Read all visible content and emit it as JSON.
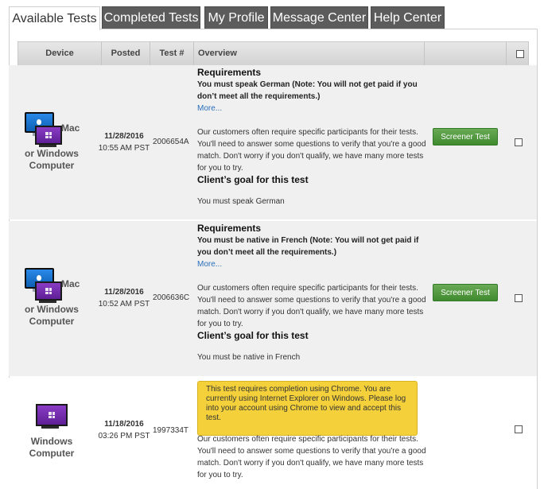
{
  "tabs": [
    {
      "label": "Available Tests",
      "active": true
    },
    {
      "label": "Completed Tests",
      "active": false
    },
    {
      "label": "My Profile",
      "active": false
    },
    {
      "label": "Message Center",
      "active": false
    },
    {
      "label": "Help Center",
      "active": false
    }
  ],
  "table": {
    "headers": {
      "device": "Device",
      "posted": "Posted",
      "test_number": "Test #",
      "overview": "Overview"
    }
  },
  "rows": [
    {
      "device": {
        "line1": "Mac",
        "line2": "or Windows",
        "line3": "Computer"
      },
      "posted_date": "11/28/2016",
      "posted_time": "10:55 AM PST",
      "test_number": "2006654A",
      "requirements_heading": "Requirements",
      "requirement_text": "You must speak German (Note: You will not get paid if you don’t meet all the requirements.)",
      "more_link": "More...",
      "description": "Our customers often require specific participants for their tests. You'll need to answer some questions to verify that you're a good match. Don't worry if you don't qualify, we have many more tests for you to try.",
      "goal_heading": "Client’s goal for this test",
      "goal_text": "You must speak German",
      "button_label": "Screener Test"
    },
    {
      "device": {
        "line1": "Mac",
        "line2": "or Windows",
        "line3": "Computer"
      },
      "posted_date": "11/28/2016",
      "posted_time": "10:52 AM PST",
      "test_number": "2006636C",
      "requirements_heading": "Requirements",
      "requirement_text": "You must be native in French (Note: You will not get paid if you don’t meet all the requirements.)",
      "more_link": "More...",
      "description": "Our customers often require specific participants for their tests. You'll need to answer some questions to verify that you're a good match. Don't worry if you don't qualify, we have many more tests for you to try.",
      "goal_heading": "Client’s goal for this test",
      "goal_text": "You must be native in French",
      "button_label": "Screener Test"
    },
    {
      "device": {
        "line1": "Windows",
        "line2": "Computer"
      },
      "posted_date": "11/18/2016",
      "posted_time": "03:26 PM PST",
      "test_number": "1997334T",
      "warning": "This test requires completion using Chrome. You are currently using Internet Explorer on Windows. Please log into your account using Chrome to view and accept this test.",
      "description": "Our customers often require specific participants for their tests. You'll need to answer some questions to verify that you're a good match. Don't worry if you don't qualify, we have many more tests for you to try."
    }
  ],
  "colors": {
    "tab_inactive": "#5c5c5c",
    "button_green": "#4f9a3e",
    "warning_yellow": "#f4d13a",
    "link_blue": "#2a6ebb"
  }
}
